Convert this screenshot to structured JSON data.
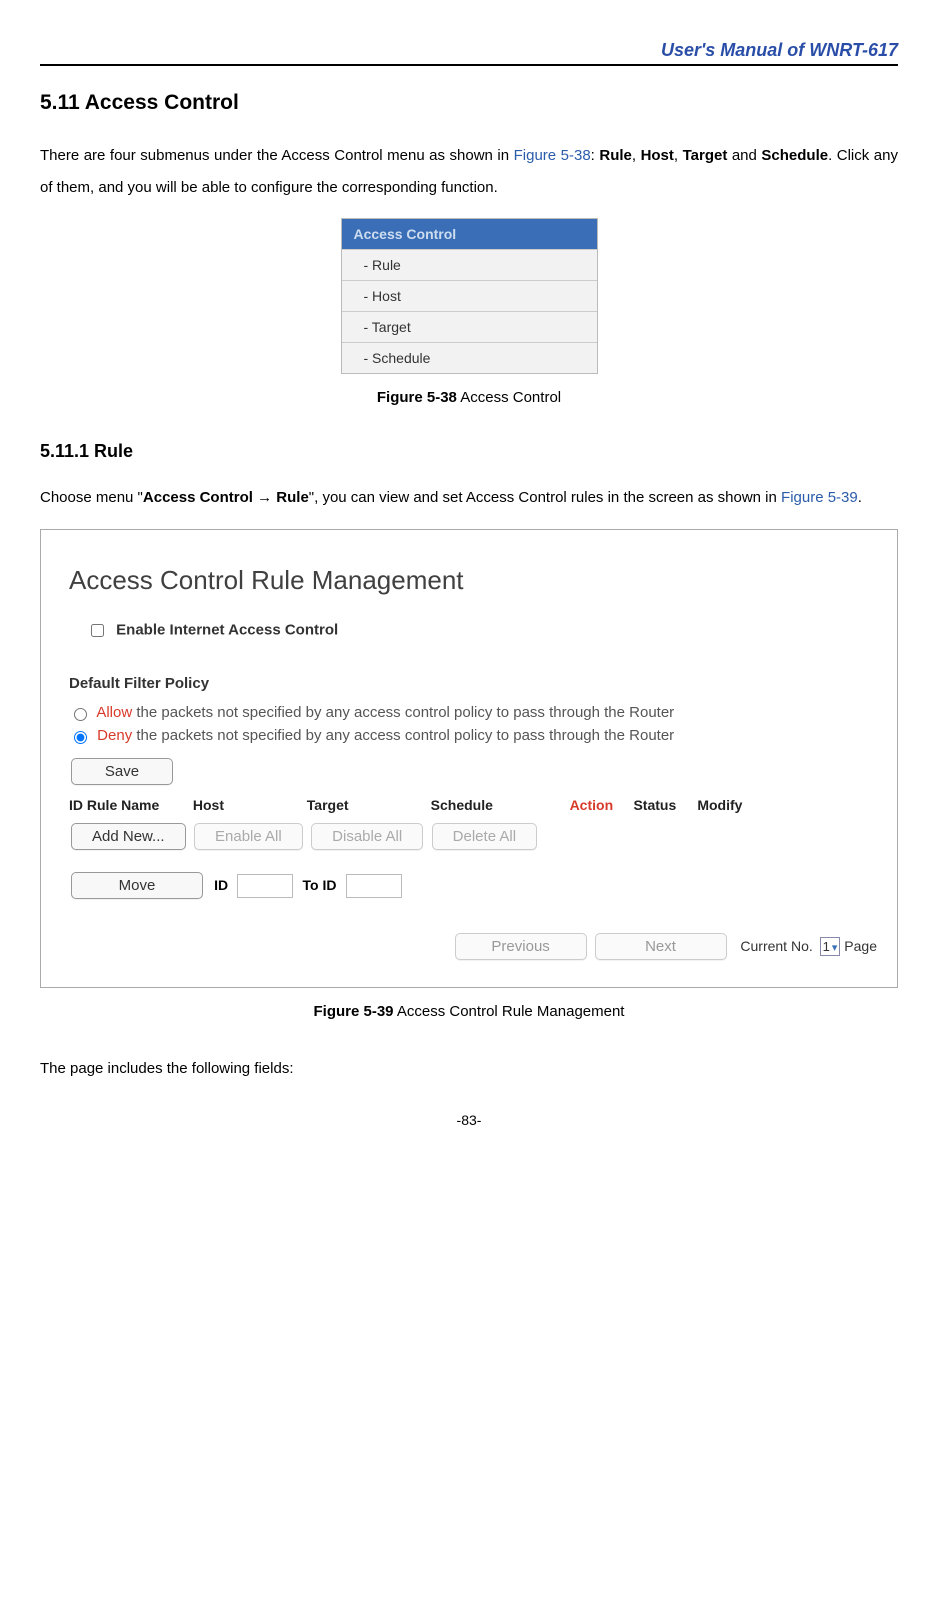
{
  "header": {
    "doc_title": "User's Manual of WNRT-617"
  },
  "section": {
    "num_title": "5.11 Access Control",
    "intro_1": "There are four submenus under the Access Control menu as shown in ",
    "intro_link": "Figure 5-38",
    "intro_2": ": ",
    "intro_b1": "Rule",
    "intro_3": ", ",
    "intro_b2": "Host",
    "intro_4": ", ",
    "intro_b3": "Target",
    "intro_5": " and ",
    "intro_b4": "Schedule",
    "intro_6": ". Click any of them, and you will be able to configure the corresponding function."
  },
  "menu": {
    "header": "Access Control",
    "items": [
      "- Rule",
      "- Host",
      "- Target",
      "- Schedule"
    ]
  },
  "fig38": {
    "label": "Figure 5-38",
    "text": " Access Control"
  },
  "subsection": {
    "num_title": "5.11.1 Rule",
    "intro_1": "Choose menu \"",
    "b1": "Access Control",
    "arrow": " → ",
    "b2": "Rule",
    "intro_2": "\", you can view and set Access Control rules in the screen as shown in ",
    "link": "Figure 5-39",
    "intro_3": "."
  },
  "panel": {
    "title": "Access Control Rule Management",
    "enable_label": "Enable Internet Access Control",
    "policy_heading": "Default Filter Policy",
    "radio1_action": "Allow",
    "radio1_text": " the packets not specified by any access control policy to pass through the Router",
    "radio2_action": "Deny",
    "radio2_text": " the packets not specified by any access control policy to pass through the Router",
    "save_btn": "Save",
    "headers": {
      "id": "ID Rule Name",
      "host": "Host",
      "target": "Target",
      "schedule": "Schedule",
      "action": "Action",
      "status": "Status",
      "modify": "Modify"
    },
    "buttons": {
      "add": "Add New...",
      "enable_all": "Enable All",
      "disable_all": "Disable All",
      "delete_all": "Delete All",
      "move": "Move",
      "previous": "Previous",
      "next": "Next"
    },
    "move_labels": {
      "id": "ID",
      "to_id": "To ID"
    },
    "pager": {
      "current": "Current No.",
      "value": "1",
      "page": "Page"
    }
  },
  "fig39": {
    "label": "Figure 5-39",
    "text": "  Access Control Rule Management"
  },
  "footer": "The page includes the following fields:",
  "pagenum": "-83-"
}
